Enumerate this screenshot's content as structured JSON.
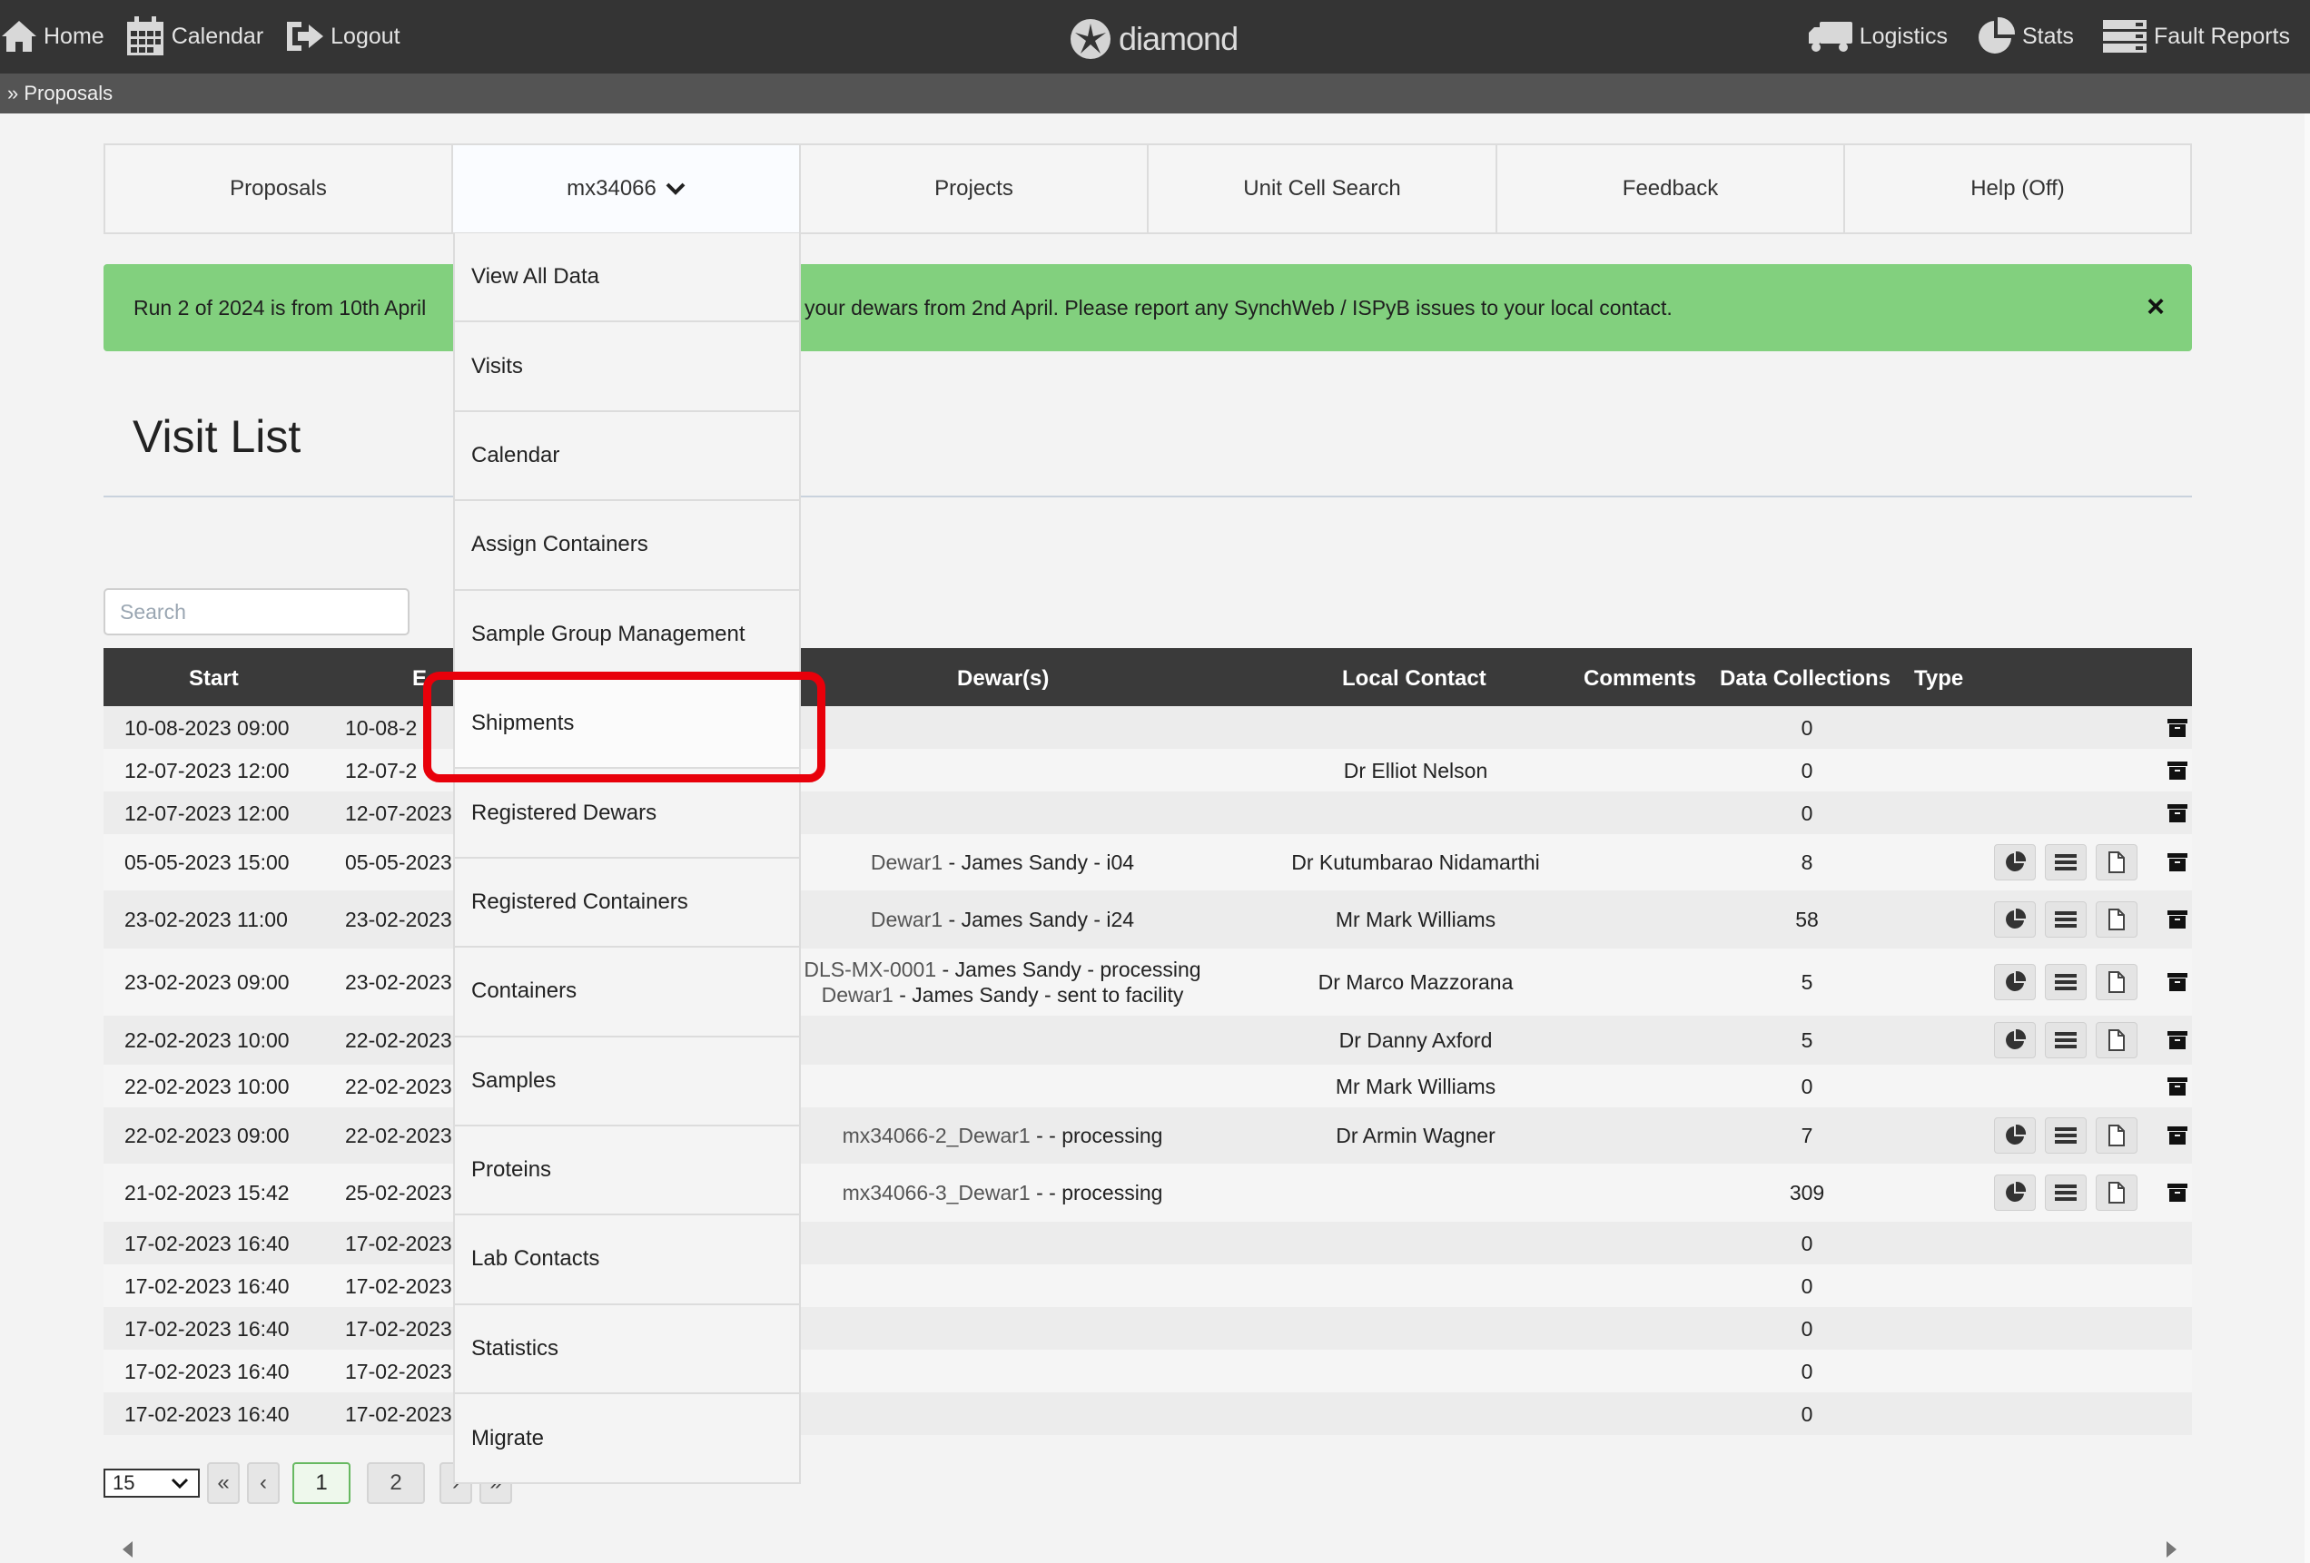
{
  "topbar": {
    "nav_left": [
      {
        "label": "Home",
        "icon": "home-icon"
      },
      {
        "label": "Calendar",
        "icon": "calendar-icon"
      },
      {
        "label": "Logout",
        "icon": "logout-icon"
      }
    ],
    "logo_text": "diamond",
    "nav_right": [
      {
        "label": "Logistics",
        "icon": "truck-icon"
      },
      {
        "label": "Stats",
        "icon": "pie-chart-icon"
      },
      {
        "label": "Fault Reports",
        "icon": "server-icon"
      }
    ]
  },
  "breadcrumb": "» Proposals",
  "tabs": [
    {
      "label": "Proposals"
    },
    {
      "label": "mx34066",
      "has_dropdown": true
    },
    {
      "label": "Projects"
    },
    {
      "label": "Unit Cell Search"
    },
    {
      "label": "Feedback"
    },
    {
      "label": "Help (Off)"
    }
  ],
  "banner": {
    "text_start": "Run 2 of 2024 is from 10th April",
    "text_end": "your dewars from 2nd April. Please report any SynchWeb / ISPyB issues to your local contact.",
    "close": "×",
    "color": "#82d07e"
  },
  "page": {
    "title": "Visit List"
  },
  "search": {
    "placeholder": "Search"
  },
  "table": {
    "headers": {
      "start": "Start",
      "end": "E",
      "dewars": "Dewar(s)",
      "local_contact": "Local Contact",
      "comments": "Comments",
      "data_collections": "Data Collections",
      "type": "Type"
    },
    "rows": [
      {
        "start": "10-08-2023 09:00",
        "end": "10-08-2",
        "dewars": [],
        "contact": "",
        "dc": "0",
        "actions": false,
        "archive": true
      },
      {
        "start": "12-07-2023 12:00",
        "end": "12-07-2",
        "dewars": [],
        "contact": "Dr Elliot Nelson",
        "dc": "0",
        "actions": false,
        "archive": true
      },
      {
        "start": "12-07-2023 12:00",
        "end": "12-07-2023",
        "dewars": [],
        "contact": "",
        "dc": "0",
        "actions": false,
        "archive": true
      },
      {
        "start": "05-05-2023 15:00",
        "end": "05-05-2023",
        "dewars": [
          {
            "name": "Dewar1",
            "detail": " - James Sandy - i04"
          }
        ],
        "contact": "Dr Kutumbarao Nidamarthi",
        "dc": "8",
        "actions": true,
        "archive": true
      },
      {
        "start": "23-02-2023 11:00",
        "end": "23-02-2023",
        "dewars": [
          {
            "name": "Dewar1",
            "detail": " - James Sandy - i24"
          }
        ],
        "contact": "Mr Mark Williams",
        "dc": "58",
        "actions": true,
        "archive": true
      },
      {
        "start": "23-02-2023 09:00",
        "end": "23-02-2023",
        "dewars": [
          {
            "name": "DLS-MX-0001",
            "detail": " - James Sandy - processing"
          },
          {
            "name": "Dewar1",
            "detail": " - James Sandy - sent to facility"
          }
        ],
        "contact": "Dr Marco Mazzorana",
        "dc": "5",
        "actions": true,
        "archive": true
      },
      {
        "start": "22-02-2023 10:00",
        "end": "22-02-2023",
        "dewars": [],
        "contact": "Dr Danny Axford",
        "dc": "5",
        "actions": true,
        "archive": true
      },
      {
        "start": "22-02-2023 10:00",
        "end": "22-02-2023",
        "dewars": [],
        "contact": "Mr Mark Williams",
        "dc": "0",
        "actions": false,
        "archive": true
      },
      {
        "start": "22-02-2023 09:00",
        "end": "22-02-2023",
        "dewars": [
          {
            "name": "mx34066-2_Dewar1",
            "detail": " - - processing"
          }
        ],
        "contact": "Dr Armin Wagner",
        "dc": "7",
        "actions": true,
        "archive": true
      },
      {
        "start": "21-02-2023 15:42",
        "end": "25-02-2023",
        "dewars": [
          {
            "name": "mx34066-3_Dewar1",
            "detail": " - - processing"
          }
        ],
        "contact": "",
        "dc": "309",
        "actions": true,
        "archive": true
      },
      {
        "start": "17-02-2023 16:40",
        "end": "17-02-2023",
        "dewars": [],
        "contact": "",
        "dc": "0",
        "actions": false,
        "archive": false
      },
      {
        "start": "17-02-2023 16:40",
        "end": "17-02-2023",
        "dewars": [],
        "contact": "",
        "dc": "0",
        "actions": false,
        "archive": false
      },
      {
        "start": "17-02-2023 16:40",
        "end": "17-02-2023",
        "dewars": [],
        "contact": "",
        "dc": "0",
        "actions": false,
        "archive": false
      },
      {
        "start": "17-02-2023 16:40",
        "end": "17-02-2023",
        "dewars": [],
        "contact": "",
        "dc": "0",
        "actions": false,
        "archive": false
      },
      {
        "start": "17-02-2023 16:40",
        "end": "17-02-2023",
        "dewars": [],
        "contact": "",
        "dc": "0",
        "actions": false,
        "archive": false
      }
    ]
  },
  "pagination": {
    "per_page": "15",
    "first": "«",
    "prev": "‹",
    "pages": [
      "1",
      "2"
    ],
    "active_page": "1",
    "next": "›",
    "last": "»"
  },
  "dropdown": {
    "items": [
      "View All Data",
      "Visits",
      "Calendar",
      "Assign Containers",
      "Sample Group Management",
      "Shipments",
      "Registered Dewars",
      "Registered Containers",
      "Containers",
      "Samples",
      "Proteins",
      "Lab Contacts",
      "Statistics",
      "Migrate"
    ],
    "highlighted": "Shipments",
    "highlight_color": "#e8000a"
  }
}
